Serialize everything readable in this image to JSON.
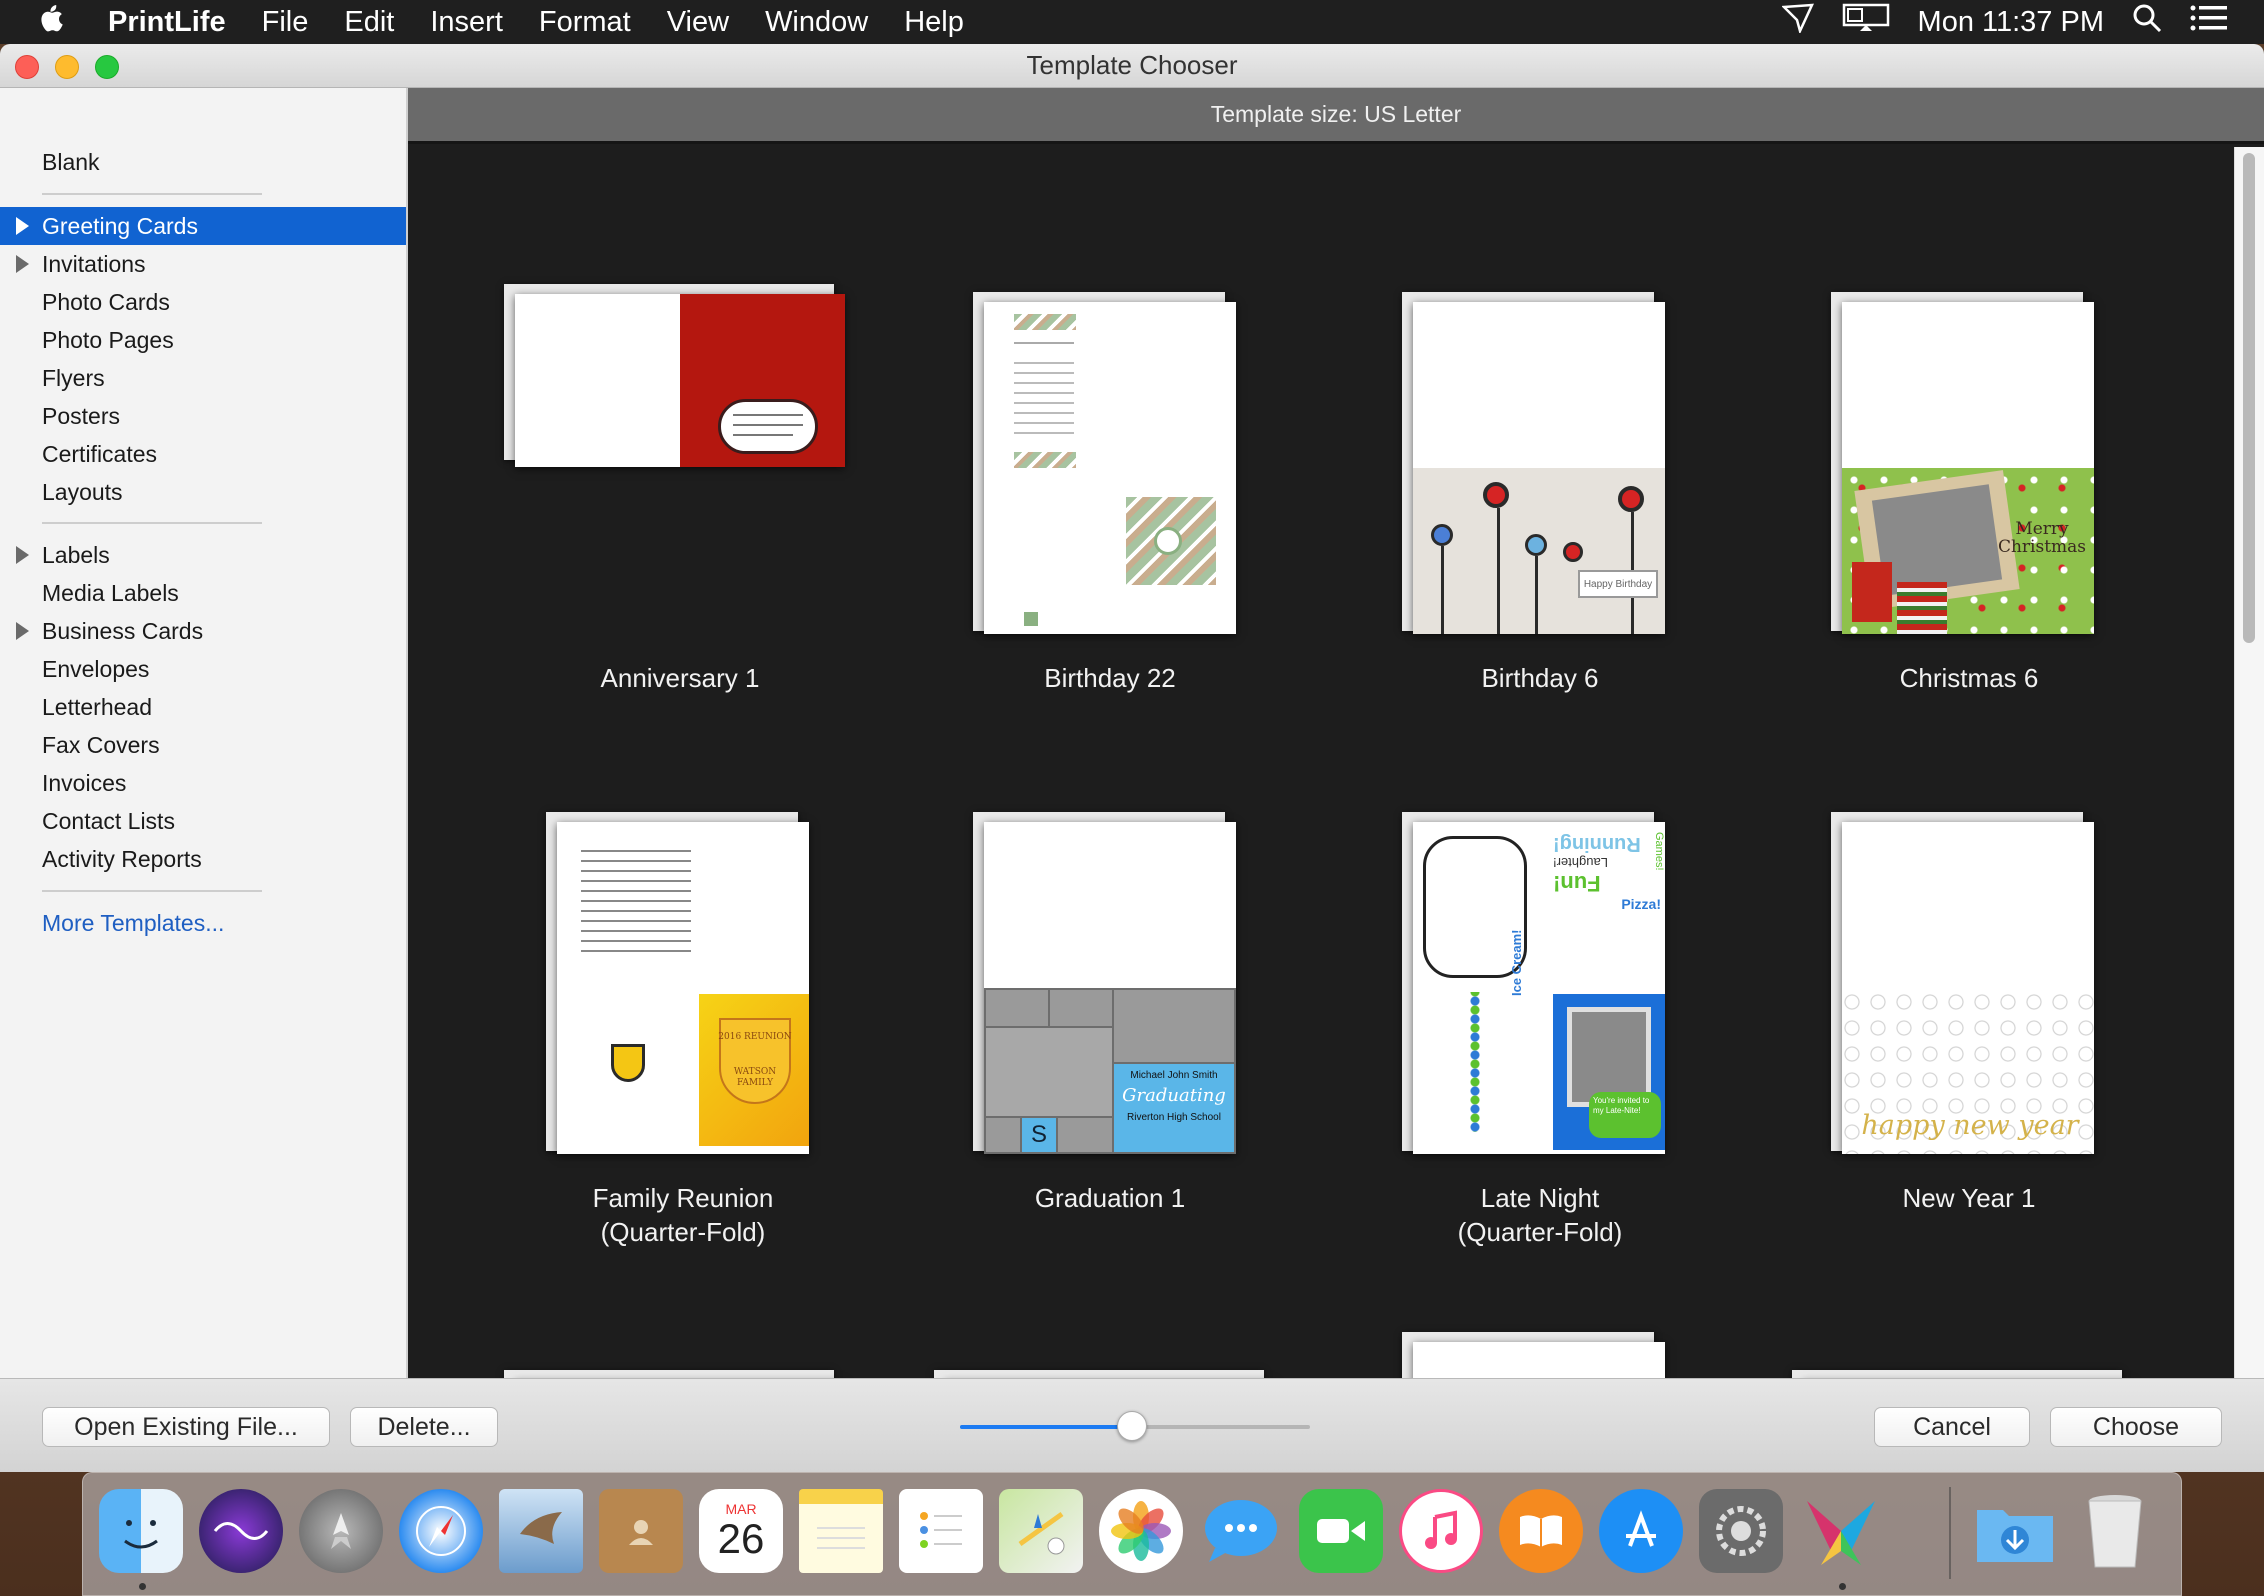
{
  "menubar": {
    "app_name": "PrintLife",
    "menus": [
      "File",
      "Edit",
      "Insert",
      "Format",
      "View",
      "Window",
      "Help"
    ],
    "clock": "Mon 11:37 PM"
  },
  "window": {
    "title": "Template Chooser"
  },
  "sidebar": {
    "items": [
      {
        "label": "Blank"
      },
      {
        "label": "Greeting Cards"
      },
      {
        "label": "Invitations"
      },
      {
        "label": "Photo Cards"
      },
      {
        "label": "Photo Pages"
      },
      {
        "label": "Flyers"
      },
      {
        "label": "Posters"
      },
      {
        "label": "Certificates"
      },
      {
        "label": "Layouts"
      },
      {
        "label": "Labels"
      },
      {
        "label": "Media Labels"
      },
      {
        "label": "Business Cards"
      },
      {
        "label": "Envelopes"
      },
      {
        "label": "Letterhead"
      },
      {
        "label": "Fax Covers"
      },
      {
        "label": "Invoices"
      },
      {
        "label": "Contact Lists"
      },
      {
        "label": "Activity Reports"
      },
      {
        "label": "More Templates..."
      }
    ]
  },
  "main": {
    "template_size": "Template size: US Letter",
    "templates": [
      {
        "line1": "Anniversary 1",
        "line2": ""
      },
      {
        "line1": "Birthday 22",
        "line2": ""
      },
      {
        "line1": "Birthday 6",
        "line2": ""
      },
      {
        "line1": "Christmas 6",
        "line2": ""
      },
      {
        "line1": "Family Reunion",
        "line2": "(Quarter-Fold)"
      },
      {
        "line1": "Graduation 1",
        "line2": ""
      },
      {
        "line1": "Late Night",
        "line2": "(Quarter-Fold)"
      },
      {
        "line1": "New Year 1",
        "line2": ""
      }
    ],
    "thumb_text": {
      "christmas": "Merry Christmas",
      "grad_name": "Michael John Smith",
      "grad_script": "Graduating",
      "grad_school": "Riverton High School",
      "grad_letter": "S",
      "late_night_invite": "You're invited to my Late-Nite!",
      "late_words": [
        "Running!",
        "Laughter!",
        "Fun!",
        "Pizza!",
        "Ice Cream!",
        "Games!"
      ],
      "new_year": "happy new year",
      "reunion": "2016 REUNION",
      "reunion_family": "WATSON FAMILY",
      "birthday_banner": "Happy Birthday"
    }
  },
  "footer": {
    "open_label": "Open Existing File...",
    "delete_label": "Delete...",
    "cancel_label": "Cancel",
    "choose_label": "Choose",
    "zoom_level": 0.49
  },
  "dock": {
    "calendar_month": "MAR",
    "calendar_day": "26",
    "apps": [
      "finder-icon",
      "siri-icon",
      "launchpad-icon",
      "safari-icon",
      "mail-icon",
      "contacts-icon",
      "calendar-icon",
      "notes-icon",
      "reminders-icon",
      "maps-icon",
      "photos-icon",
      "messages-icon",
      "facetime-icon",
      "itunes-icon",
      "ibooks-icon",
      "app-store-icon",
      "system-preferences-icon",
      "printlife-icon",
      "downloads-icon",
      "trash-icon"
    ]
  },
  "colors": {
    "selection": "#1163d1",
    "link": "#1e5ec2",
    "slider": "#1c7bf2"
  }
}
